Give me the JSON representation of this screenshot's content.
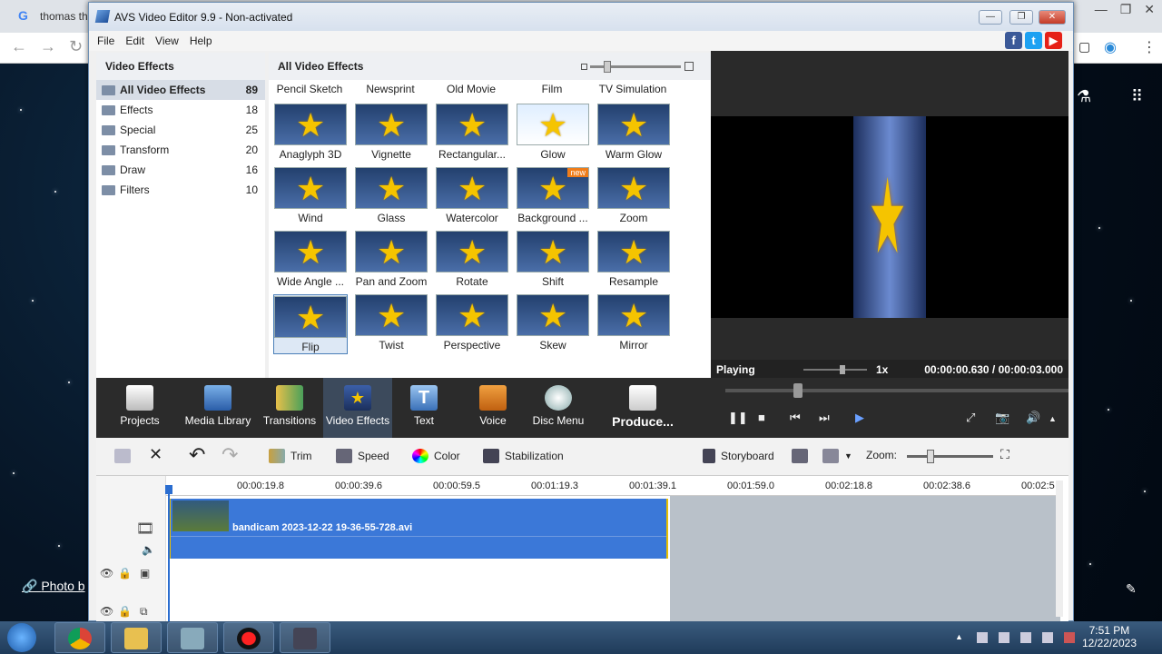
{
  "browser": {
    "tab_title": "thomas th",
    "photo_credit": "Photo b"
  },
  "window": {
    "title": "AVS Video Editor 9.9 - Non-activated",
    "minimize": "—",
    "restore": "❐",
    "close": "✕"
  },
  "menu": [
    "File",
    "Edit",
    "View",
    "Help"
  ],
  "social": [
    "f",
    "t",
    "▶"
  ],
  "left_panel": {
    "title": "Video Effects",
    "categories": [
      {
        "label": "All Video Effects",
        "count": "89"
      },
      {
        "label": "Effects",
        "count": "18"
      },
      {
        "label": "Special",
        "count": "25"
      },
      {
        "label": "Transform",
        "count": "20"
      },
      {
        "label": "Draw",
        "count": "16"
      },
      {
        "label": "Filters",
        "count": "10"
      }
    ]
  },
  "effects_panel": {
    "title": "All Video Effects",
    "top_row": [
      "Pencil Sketch",
      "Newsprint",
      "Old Movie",
      "Film",
      "TV Simulation"
    ],
    "tiles": [
      "Anaglyph 3D",
      "Vignette",
      "Rectangular...",
      "Glow",
      "Warm Glow",
      "Wind",
      "Glass",
      "Watercolor",
      "Background ...",
      "Zoom",
      "Wide Angle ...",
      "Pan and Zoom",
      "Rotate",
      "Shift",
      "Resample",
      "Flip",
      "Twist",
      "Perspective",
      "Skew",
      "Mirror"
    ],
    "new_badge": "new",
    "selected": "Flip"
  },
  "preview": {
    "status": "Playing",
    "speed": "1x",
    "time": "00:00:00.630 / 00:00:03.000"
  },
  "main_toolbar": {
    "buttons": [
      "Projects",
      "Media Library",
      "Transitions",
      "Video Effects",
      "Text",
      "Voice",
      "Disc Menu",
      "Produce..."
    ],
    "active": "Video Effects"
  },
  "playback": {
    "pause": "❚❚",
    "stop": "■",
    "prev": "⏮",
    "next": "⏭",
    "frame": "▶",
    "fullscreen": "⤢",
    "snapshot": "📷",
    "volume": "🔊",
    "more": "▲"
  },
  "edit_toolbar": {
    "delete": "✕",
    "undo": "↶",
    "redo": "↷",
    "trim": "Trim",
    "speed": "Speed",
    "color": "Color",
    "stabilization": "Stabilization",
    "storyboard": "Storyboard",
    "zoom": "Zoom:"
  },
  "timeline": {
    "ticks": [
      "00:00:19.8",
      "00:00:39.6",
      "00:00:59.5",
      "00:01:19.3",
      "00:01:39.1",
      "00:01:59.0",
      "00:02:18.8",
      "00:02:38.6",
      "00:02:5"
    ],
    "clip_name": "bandicam 2023-12-22 19-36-55-728.avi"
  },
  "taskbar": {
    "time": "7:51 PM",
    "date": "12/22/2023"
  }
}
